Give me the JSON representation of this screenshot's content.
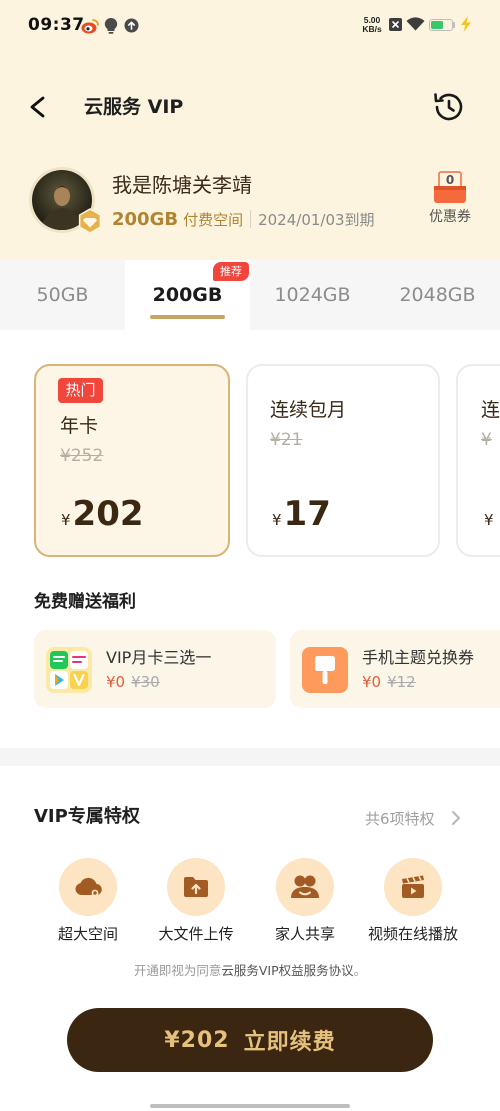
{
  "status_bar": {
    "time": "09:37",
    "left_icons": [
      "weibo-icon",
      "bulb-icon",
      "upload-circle-icon"
    ],
    "net_speed": "5.00",
    "net_speed_unit": "KB/s",
    "right_icons": [
      "sim-off-icon",
      "wifi-icon",
      "battery-icon",
      "charging-icon"
    ],
    "battery_level": 0.6
  },
  "header": {
    "title": "云服务 VIP",
    "back_icon": "back-arrow-icon",
    "history_icon": "history-icon"
  },
  "profile": {
    "name": "我是陈塘关李靖",
    "storage": "200GB",
    "storage_label": "付费空间",
    "expiry": "2024/01/03到期",
    "badge_icon": "diamond-icon",
    "coupon_icon": "coupon-icon",
    "coupon_count": "0",
    "coupon_label": "优惠券"
  },
  "tabs": {
    "selected_index": 1,
    "items": [
      {
        "label": "50GB"
      },
      {
        "label": "200GB",
        "badge": "推荐"
      },
      {
        "label": "1024GB"
      },
      {
        "label": "2048GB"
      }
    ]
  },
  "plans": {
    "selected_index": 0,
    "items": [
      {
        "badge": "热门",
        "name": "年卡",
        "original_price": "¥252",
        "currency": "¥",
        "price": "202"
      },
      {
        "name": "连续包月",
        "original_price": "¥21",
        "currency": "¥",
        "price": "17"
      },
      {
        "name": "连",
        "original_price": "¥",
        "currency": "¥"
      }
    ]
  },
  "gifts": {
    "title": "免费赠送福利",
    "items": [
      {
        "icon": "video-apps-bundle-icon",
        "title": "VIP月卡三选一",
        "price": "¥0",
        "original_price": "¥30"
      },
      {
        "icon": "theme-brush-icon",
        "title": "手机主题兑换券",
        "price": "¥0",
        "original_price": "¥12"
      }
    ]
  },
  "privileges": {
    "title": "VIP专属特权",
    "more_label": "共6项特权",
    "more_icon": "chevron-right-icon",
    "items": [
      {
        "icon": "cloud-storage-icon",
        "label": "超大空间"
      },
      {
        "icon": "folder-upload-icon",
        "label": "大文件上传"
      },
      {
        "icon": "family-share-icon",
        "label": "家人共享"
      },
      {
        "icon": "video-clapper-icon",
        "label": "视频在线播放"
      }
    ]
  },
  "agreement": {
    "prefix": "开通即视为同意",
    "link": "云服务VIP权益服务协议",
    "suffix": "。"
  },
  "cta": {
    "currency": "¥",
    "price": "202",
    "label": "立即续费"
  },
  "colors": {
    "header_bg": "#fcf4df",
    "accent_gold": "#c8a25f",
    "gold_text": "#b08432",
    "hot_red": "#f0463b",
    "selected_card_border": "#d8b577",
    "selected_card_bg": "#fdf6e6",
    "gift_bg": "#fcf6e8",
    "gift_price": "#e25a3b",
    "privilege_icon_bg": "#fde4c3",
    "privilege_icon": "#a35b24",
    "cta_bg": "#3a2611",
    "cta_text": "#e6c17d",
    "battery_green": "#3ac66a"
  }
}
